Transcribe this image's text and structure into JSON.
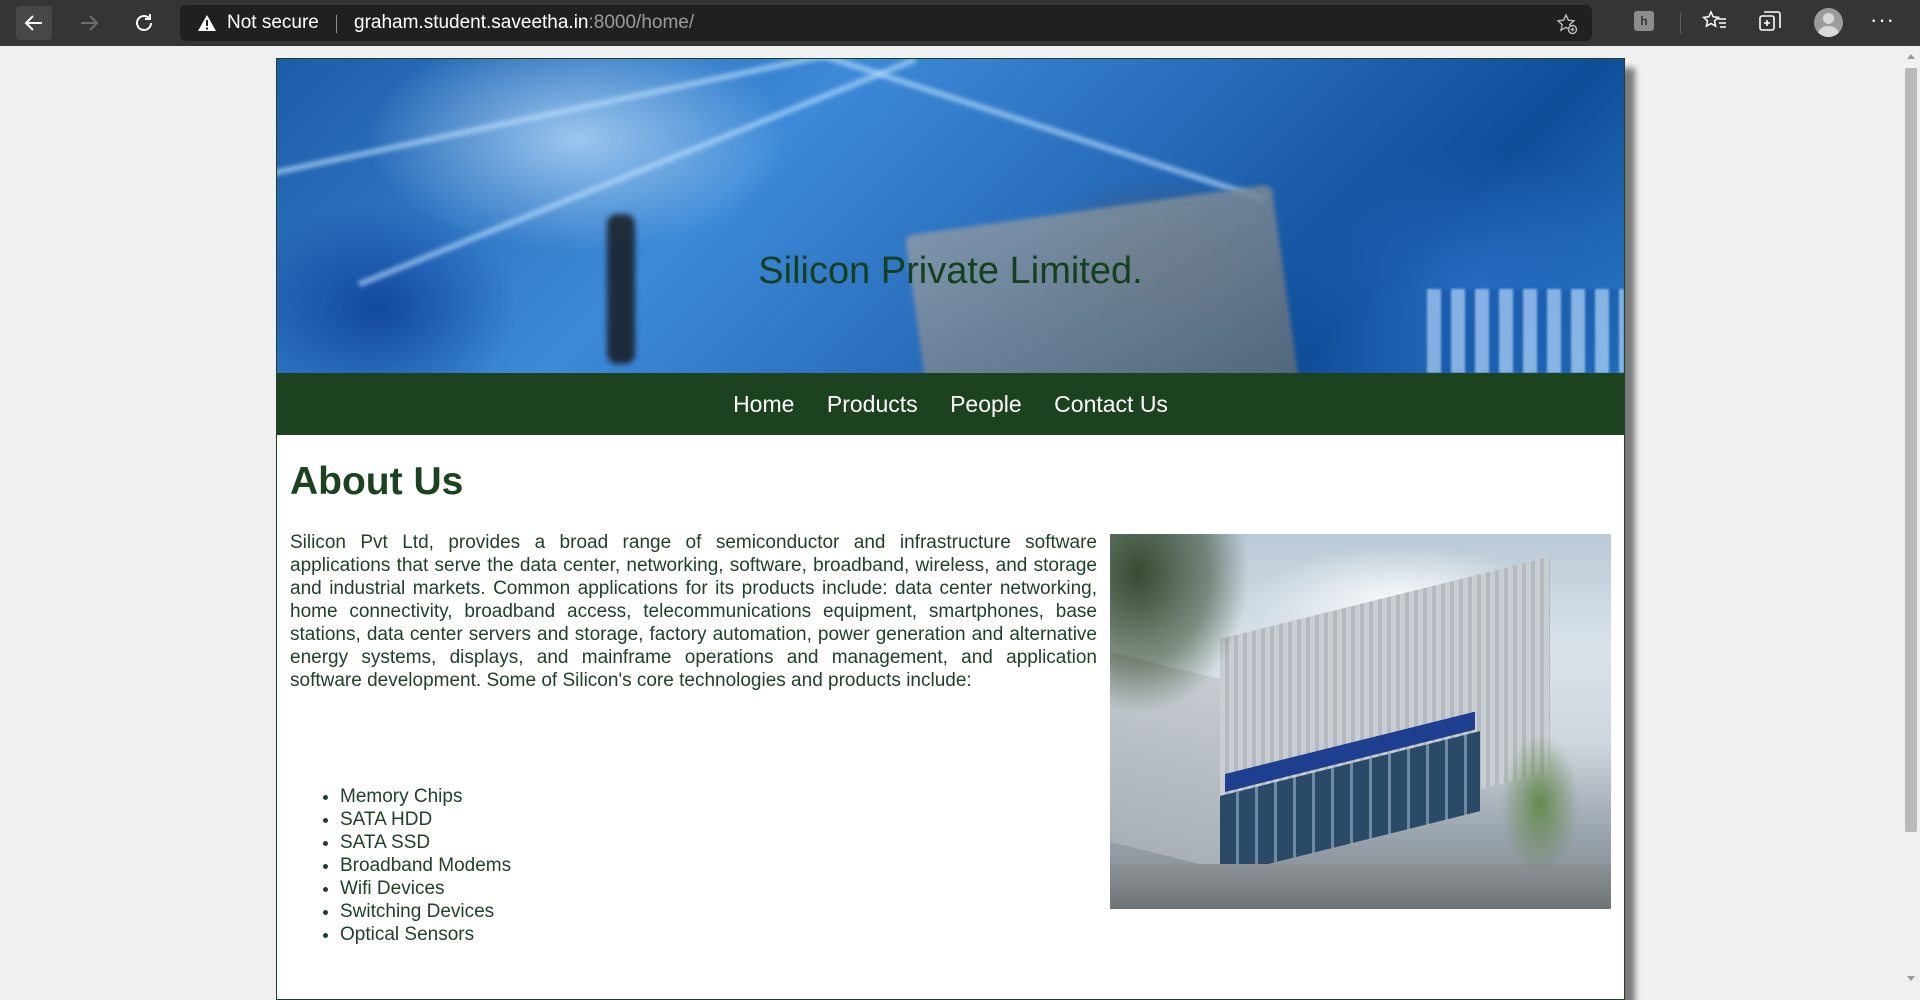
{
  "browser": {
    "security_label": "Not secure",
    "url_host": "graham.student.saveetha.in",
    "url_path": ":8000/home/",
    "extension_label": "h"
  },
  "site": {
    "title": "Silicon Private Limited."
  },
  "nav": {
    "items": [
      "Home",
      "Products",
      "People",
      "Contact Us"
    ]
  },
  "about": {
    "heading": "About Us",
    "text": "Silicon Pvt Ltd, provides a broad range of semiconductor and infrastructure software applications that serve the data center, networking, software, broadband, wireless, and storage and industrial markets. Common applications for its products include: data center networking, home connectivity, broadband access, telecommunications equipment, smartphones, base stations, data center servers and storage, factory automation, power generation and alternative energy systems, displays, and mainframe operations and management, and application software development. Some of Silicon's core technologies and products include:",
    "products": [
      "Memory Chips",
      "SATA HDD",
      "SATA SSD",
      "Broadband Modems",
      "Wifi Devices",
      "Switching Devices",
      "Optical Sensors"
    ]
  },
  "colors": {
    "brand_green": "#1c4220",
    "chrome_dark": "#353535"
  }
}
